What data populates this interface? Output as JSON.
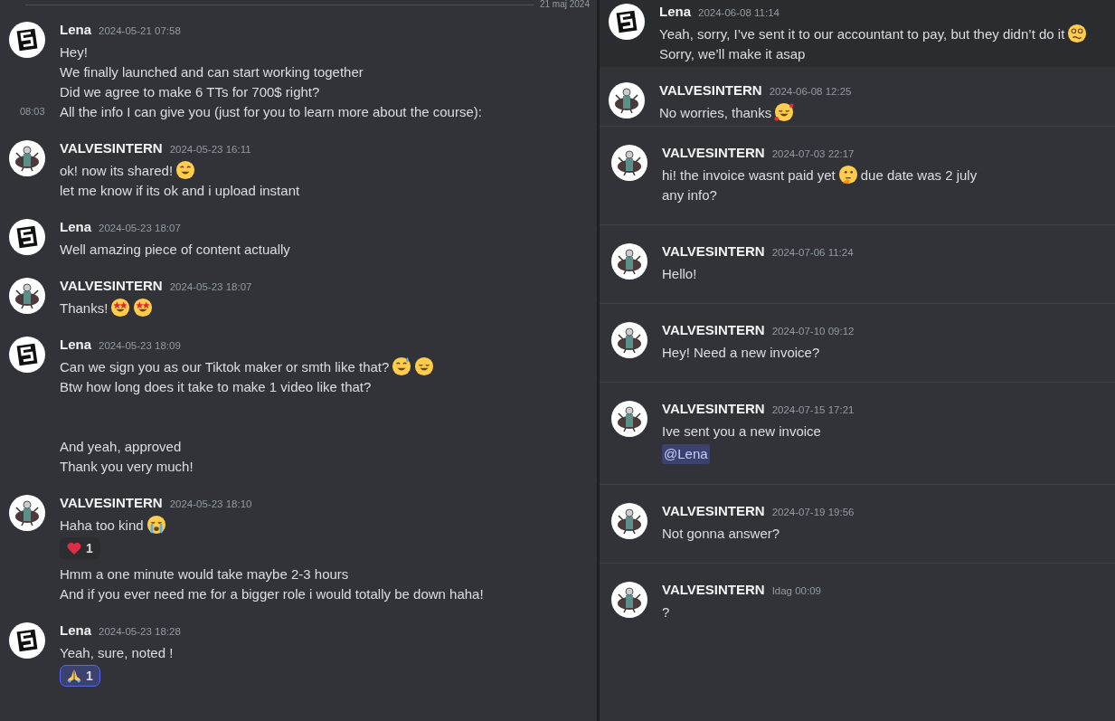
{
  "date_divider": "21 maj 2024",
  "columns": [
    {
      "messages": [
        {
          "author": "Lena",
          "kind": "logo",
          "timestamp": "2024-05-21 07:58",
          "content": [
            {
              "kind": "text",
              "parts": [
                {
                  "kind": "text",
                  "text": "Hey!"
                }
              ]
            },
            {
              "kind": "text",
              "parts": [
                {
                  "kind": "text",
                  "text": "We finally launched and can start working together"
                }
              ]
            },
            {
              "kind": "text",
              "parts": [
                {
                  "kind": "text",
                  "text": "Did we agree to make 6 TTs for 700$ right?"
                }
              ]
            },
            {
              "kind": "text",
              "hover_time": "08:03",
              "parts": [
                {
                  "kind": "text",
                  "text": "All the info I can give you (just for you to learn more about the course):"
                }
              ]
            }
          ]
        },
        {
          "author": "VALVESINTERN",
          "kind": "figure",
          "timestamp": "2024-05-23 16:11",
          "content": [
            {
              "kind": "text",
              "parts": [
                {
                  "kind": "text",
                  "text": "ok! now its shared!"
                },
                {
                  "kind": "grin"
                }
              ]
            },
            {
              "kind": "text",
              "parts": [
                {
                  "kind": "text",
                  "text": "let me know if its ok and i upload instant"
                }
              ]
            }
          ]
        },
        {
          "author": "Lena",
          "kind": "logo",
          "timestamp": "2024-05-23 18:07",
          "content": [
            {
              "kind": "text",
              "parts": [
                {
                  "kind": "text",
                  "text": "Well amazing piece of content actually"
                }
              ]
            }
          ]
        },
        {
          "author": "VALVESINTERN",
          "kind": "figure",
          "timestamp": "2024-05-23 18:07",
          "content": [
            {
              "kind": "text",
              "parts": [
                {
                  "kind": "text",
                  "text": "Thanks!"
                },
                {
                  "kind": "stareyes"
                },
                {
                  "kind": "stareyes"
                }
              ]
            }
          ]
        },
        {
          "author": "Lena",
          "kind": "logo",
          "timestamp": "2024-05-23 18:09",
          "content": [
            {
              "kind": "text",
              "parts": [
                {
                  "kind": "text",
                  "text": "Can we sign you as our Tiktok maker or smth like that?"
                },
                {
                  "kind": "sweat"
                },
                {
                  "kind": "relieved"
                }
              ]
            },
            {
              "kind": "text",
              "parts": [
                {
                  "kind": "text",
                  "text": "Btw how long does it take to make 1 video like that?"
                }
              ]
            },
            {
              "kind": "spacer"
            },
            {
              "kind": "text",
              "parts": [
                {
                  "kind": "text",
                  "text": "And yeah, approved"
                }
              ]
            },
            {
              "kind": "text",
              "parts": [
                {
                  "kind": "text",
                  "text": "Thank you very much!"
                }
              ]
            }
          ]
        },
        {
          "author": "VALVESINTERN",
          "kind": "figure",
          "timestamp": "2024-05-23 18:10",
          "content": [
            {
              "kind": "text",
              "parts": [
                {
                  "kind": "text",
                  "text": "Haha too kind"
                },
                {
                  "kind": "crying"
                }
              ]
            },
            {
              "kind": "reactions",
              "reactions": [
                {
                  "kind": "heart",
                  "count": "1",
                  "selected": false
                }
              ]
            },
            {
              "kind": "text",
              "parts": [
                {
                  "kind": "text",
                  "text": "Hmm a one minute would take maybe 2-3 hours"
                }
              ]
            },
            {
              "kind": "text",
              "parts": [
                {
                  "kind": "text",
                  "text": "And if you ever need me for a bigger role i would totally be down haha!"
                }
              ]
            }
          ]
        },
        {
          "author": "Lena",
          "kind": "logo",
          "timestamp": "2024-05-23 18:28",
          "content": [
            {
              "kind": "text",
              "parts": [
                {
                  "kind": "text",
                  "text": "Yeah, sure, noted !"
                }
              ]
            },
            {
              "kind": "reactions",
              "reactions": [
                {
                  "kind": "pray",
                  "count": "1",
                  "selected": true
                }
              ]
            }
          ]
        }
      ]
    },
    {
      "messages": [
        {
          "author": "Lena",
          "kind": "logo",
          "timestamp": "2024-06-08 11:14",
          "highlighted": true,
          "content": [
            {
              "kind": "text",
              "parts": [
                {
                  "kind": "text",
                  "text": "Yeah, sorry, I’ve sent it to our accountant to pay, but they didn’t do it"
                },
                {
                  "kind": "woozy"
                }
              ]
            },
            {
              "kind": "text",
              "parts": [
                {
                  "kind": "text",
                  "text": "Sorry, we’ll make it asap"
                }
              ]
            }
          ]
        },
        {
          "author": "VALVESINTERN",
          "kind": "figure",
          "timestamp": "2024-06-08 12:25",
          "content": [
            {
              "kind": "text",
              "parts": [
                {
                  "kind": "text",
                  "text": "No worries, thanks"
                },
                {
                  "kind": "hearts"
                }
              ]
            }
          ]
        },
        {
          "author": "VALVESINTERN",
          "kind": "figure",
          "timestamp": "2024-07-03 22:17",
          "content": [
            {
              "kind": "text",
              "parts": [
                {
                  "kind": "text",
                  "text": "hi! the invoice wasnt paid yet"
                },
                {
                  "kind": "thinking"
                },
                {
                  "kind": "text",
                  "text": "due date was 2 july"
                }
              ]
            },
            {
              "kind": "text",
              "parts": [
                {
                  "kind": "text",
                  "text": "any info?"
                }
              ]
            }
          ]
        },
        {
          "author": "VALVESINTERN",
          "kind": "figure",
          "timestamp": "2024-07-06 11:24",
          "content": [
            {
              "kind": "text",
              "parts": [
                {
                  "kind": "text",
                  "text": "Hello!"
                }
              ]
            }
          ]
        },
        {
          "author": "VALVESINTERN",
          "kind": "figure",
          "timestamp": "2024-07-10 09:12",
          "content": [
            {
              "kind": "text",
              "parts": [
                {
                  "kind": "text",
                  "text": "Hey! Need a new invoice?"
                }
              ]
            }
          ]
        },
        {
          "author": "VALVESINTERN",
          "kind": "figure",
          "timestamp": "2024-07-15 17:21",
          "content": [
            {
              "kind": "text",
              "parts": [
                {
                  "kind": "text",
                  "text": "Ive sent you a new invoice"
                }
              ]
            },
            {
              "kind": "mention",
              "text": "@Lena"
            }
          ]
        },
        {
          "author": "VALVESINTERN",
          "kind": "figure",
          "timestamp": "2024-07-19 19:56",
          "content": [
            {
              "kind": "text",
              "parts": [
                {
                  "kind": "text",
                  "text": "Not gonna answer?"
                }
              ]
            }
          ]
        },
        {
          "author": "VALVESINTERN",
          "kind": "figure",
          "timestamp": "Idag 00:09",
          "content": [
            {
              "kind": "text",
              "parts": [
                {
                  "kind": "text",
                  "text": "?"
                }
              ]
            }
          ]
        }
      ]
    }
  ]
}
